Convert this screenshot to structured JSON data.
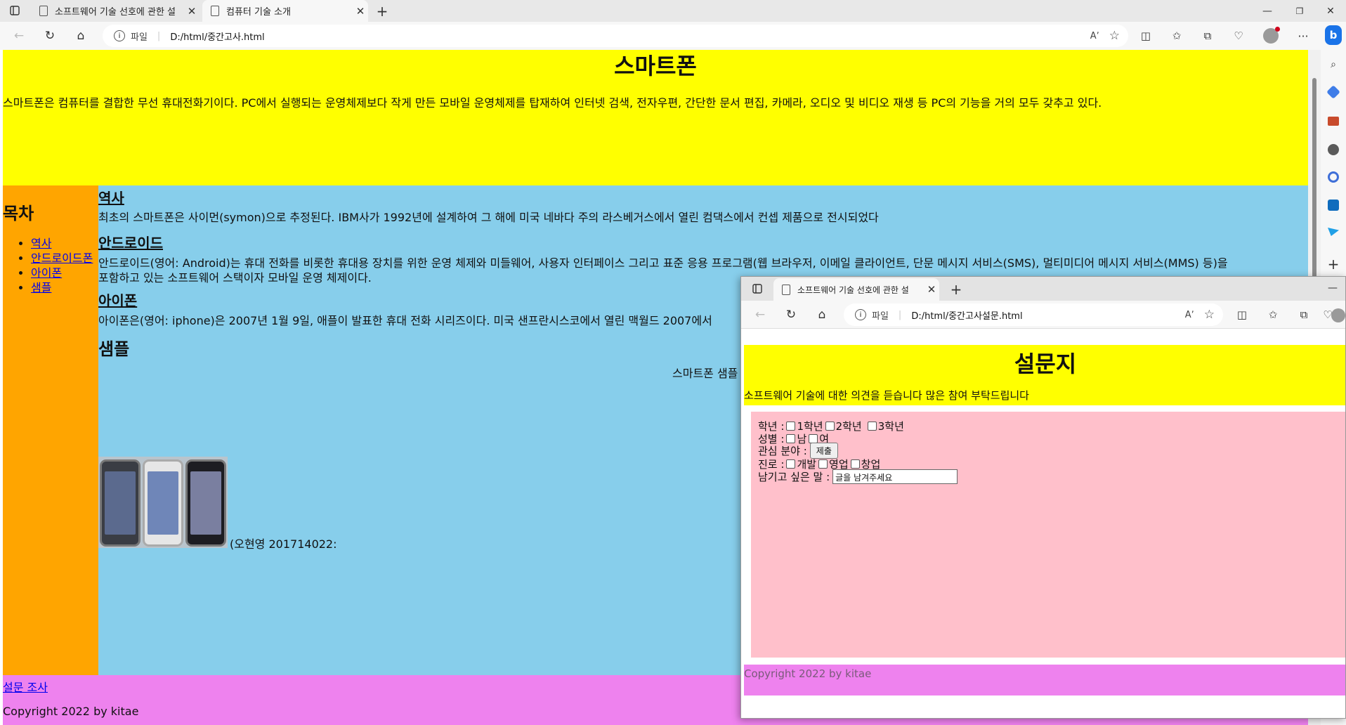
{
  "browser": {
    "tabs": [
      {
        "title": "소프트웨어 기술 선호에 관한 설",
        "active": false
      },
      {
        "title": "컴퓨터 기술 소개",
        "active": true
      }
    ],
    "address_scheme": "파일",
    "address_url": "D:/html/중간고사.html"
  },
  "page": {
    "header": {
      "title": "스마트폰",
      "intro": "스마트폰은 컴퓨터를 결합한 무선 휴대전화기이다. PC에서 실행되는 운영체제보다 작게 만든 모바일 운영체제를 탑재하여 인터넷 검색, 전자우편, 간단한 문서 편집, 카메라, 오디오 및 비디오 재생 등 PC의 기능을 거의 모두 갖추고 있다."
    },
    "nav": {
      "title": "목차",
      "links": [
        "역사",
        "안드로이드폰",
        "아이폰",
        "샘플"
      ]
    },
    "sections": [
      {
        "heading": "역사",
        "text": "최초의 스마트폰은 사이먼(symon)으로 추정된다. IBM사가 1992년에 설계하여 그 해에 미국 네바다 주의 라스베거스에서 열린 컴댁스에서 컨셉 제품으로 전시되었다"
      },
      {
        "heading": "안드로이드",
        "text_line1": "안드로이드(영어: Android)는 휴대 전화를 비롯한 휴대용 장치를 위한 운영 체제와 미들웨어, 사용자 인터페이스 그리고 표준 응용 프로그램(웹 브라우저, 이메일 클라이언트, 단문 메시지 서비스(SMS), 멀티미디어 메시지 서비스(MMS) 등)을",
        "text_line2": "포함하고 있는 소프트웨어 스택이자 모바일 운영 체제이다."
      },
      {
        "heading": "아이폰",
        "text": "아이폰은(영어: iphone)은 2007년 1월 9일, 애플이 발표한 휴대 전화 시리즈이다. 미국 샌프란시스코에서 열린 맥월드 2007에서"
      }
    ],
    "sample": {
      "heading": "샘플",
      "caption": "스마트폰 샘플",
      "credit": "(오현영 201714022:"
    },
    "footer": {
      "survey_link": "설문 조사",
      "copyright": "Copyright 2022 by kitae"
    }
  },
  "survey_window": {
    "tab_title": "소프트웨어 기술 선호에 관한 설",
    "address_scheme": "파일",
    "address_url": "D:/html/중간고사설문.html",
    "title": "설문지",
    "intro": "소프트웨어 기술에 대한 의견을 듣습니다 많은 참여 부탁드립니다",
    "grade_label": "학년 :",
    "grade_options": [
      "1학년",
      "2학년",
      "3학년"
    ],
    "gender_label": "성별 :",
    "gender_options": [
      "남",
      "여"
    ],
    "interest_label": "관심 분야 :",
    "submit_label": "제출",
    "career_label": "진로 :",
    "career_options": [
      "개발",
      "영업",
      "창업"
    ],
    "message_label": "남기고 싶은 말 :",
    "message_value": "글을 남겨주세요",
    "copyright": "Copyright 2022 by kitae"
  },
  "colors": {
    "header": "#ffff00",
    "nav": "#ffa500",
    "main": "#87ceeb",
    "footer": "#ee82ee",
    "form": "#ffc0cb"
  }
}
